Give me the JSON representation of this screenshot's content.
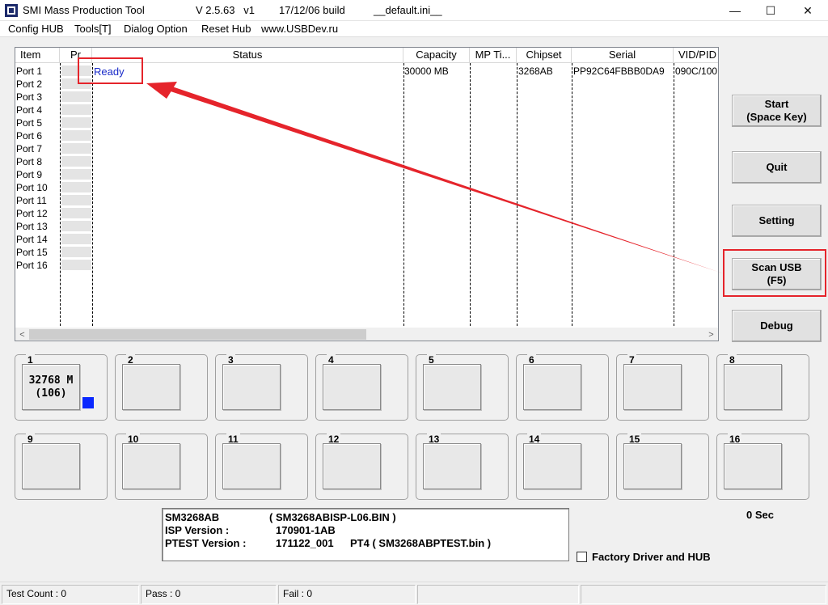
{
  "window": {
    "title": "SMI Mass Production Tool",
    "version": "V 2.5.63   v1",
    "build": "17/12/06 build",
    "ini": "__default.ini__",
    "minimize": "—",
    "maximize": "☐",
    "close": "✕"
  },
  "menu": [
    "Config HUB",
    "Tools[T]",
    "Dialog Option",
    "Reset Hub",
    "www.USBDev.ru"
  ],
  "list": {
    "columns": [
      "Item",
      "Pr",
      "Status",
      "Capacity",
      "MP Ti...",
      "Chipset",
      "Serial",
      "VID/PID"
    ],
    "rows": [
      "Port 1",
      "Port 2",
      "Port 3",
      "Port 4",
      "Port 5",
      "Port 6",
      "Port 7",
      "Port 8",
      "Port 9",
      "Port 10",
      "Port 11",
      "Port 12",
      "Port 13",
      "Port 14",
      "Port 15",
      "Port 16"
    ],
    "first_row": {
      "status": "Ready",
      "capacity": "30000 MB",
      "mp_time": "",
      "chipset": "3268AB",
      "serial": "PP92C64FBBB0DA9",
      "vidpid": "090C/100"
    },
    "scroll_left": "<",
    "scroll_right": ">"
  },
  "buttons": {
    "start": "Start\n(Space Key)",
    "quit": "Quit",
    "setting": "Setting",
    "scan": "Scan USB\n(F5)",
    "debug": "Debug"
  },
  "ports": {
    "numbers": [
      "1",
      "2",
      "3",
      "4",
      "5",
      "6",
      "7",
      "8",
      "9",
      "10",
      "11",
      "12",
      "13",
      "14",
      "15",
      "16"
    ],
    "port1_line1": "32768 M",
    "port1_line2": "(106)",
    "indicator_color": "#0a28ff"
  },
  "info": {
    "controller": "SM3268AB",
    "isp_file": "( SM3268ABISP-L06.BIN )",
    "isp_label": "ISP Version :",
    "isp_value": "170901-1AB",
    "ptest_label": "PTEST Version :",
    "ptest_value": "171122_001",
    "ptest_file": "PT4 ( SM3268ABPTEST.bin )"
  },
  "timer": "0 Sec",
  "factory_checkbox": {
    "label": "Factory Driver and HUB",
    "checked": false
  },
  "status_bar": {
    "test_count": "Test Count : 0",
    "pass": "Pass : 0",
    "fail": "Fail : 0"
  },
  "annotation_color": "#e5242b"
}
